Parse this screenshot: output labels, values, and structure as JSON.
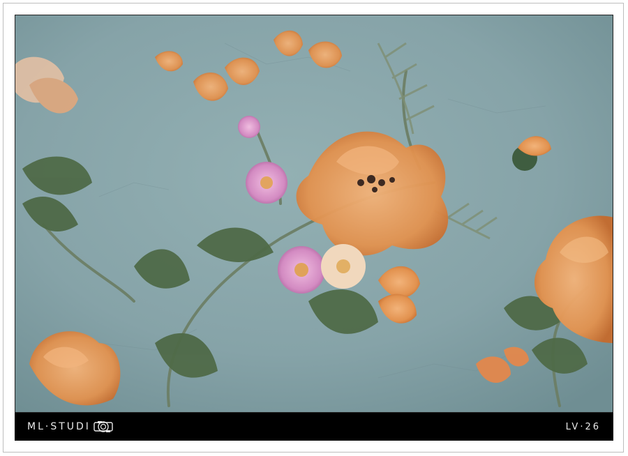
{
  "footer": {
    "brand_text": "ML·STUDI",
    "brand_logo_icon": "camera-lens-icon",
    "code": "LV·26"
  },
  "artwork": {
    "subject": "floral-wallpaper",
    "colors": {
      "background": "#8aa7ab",
      "orange": "#e59a57",
      "pink": "#d58fc0",
      "leaf": "#4f6a48"
    }
  }
}
